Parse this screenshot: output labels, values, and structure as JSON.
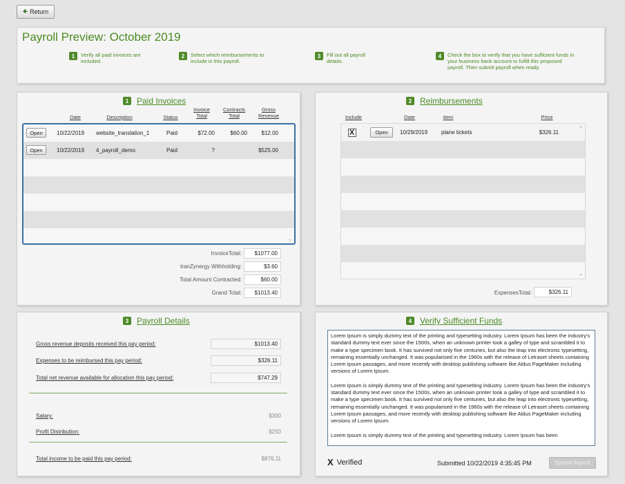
{
  "nav": {
    "return_label": "Return"
  },
  "header": {
    "title": "Payroll Preview:  October 2019",
    "steps": [
      {
        "num": "1",
        "text": "Verify all paid invoices are included."
      },
      {
        "num": "2",
        "text": "Select which reimbursements to include in this payroll."
      },
      {
        "num": "3",
        "text": "Fill out all payroll details."
      },
      {
        "num": "4",
        "text": "Check the box to verify that you have sufficient funds in your business bank account to fulfill this proposed payroll. Then submit payroll when ready."
      }
    ]
  },
  "invoices": {
    "num": "1",
    "title": "Paid Invoices",
    "columns": [
      "Date",
      "Description",
      "Status",
      "Invoice Total",
      "Contracts Total",
      "Gross Revenue"
    ],
    "open_label": "Open",
    "rows": [
      {
        "date": "10/22/2019",
        "description": "website_translation_1",
        "status": "Paid",
        "invoice_total": "$72.00",
        "contracts_total": "$60.00",
        "gross_revenue": "$12.00"
      },
      {
        "date": "10/22/2019",
        "description": "4_payroll_demo",
        "status": "Paid",
        "invoice_total": "?",
        "contracts_total": "",
        "gross_revenue": "$525.00"
      }
    ],
    "totals": [
      {
        "label": "InvoiceTotal:",
        "value": "$1077.00"
      },
      {
        "label": "tranZynergy Withholding:",
        "value": "$3.60"
      },
      {
        "label": "Total Amount Contracted:",
        "value": "$60.00"
      },
      {
        "label": "Grand Total:",
        "value": "$1013.40"
      }
    ]
  },
  "reimbursements": {
    "num": "2",
    "title": "Reimbursements",
    "columns": [
      "Include",
      "Date",
      "Item",
      "Price"
    ],
    "open_label": "Open",
    "rows": [
      {
        "include": "X",
        "date": "10/29/2019",
        "item": "plane tickets",
        "price": "$326.11"
      }
    ],
    "expenses_label": "ExpensesTotal:",
    "expenses_value": "$326.11"
  },
  "details": {
    "num": "3",
    "title": "Payroll Details",
    "gross_label": "Gross revenue deposits received this pay period:",
    "gross_value": "$1013.40",
    "expenses_label": "Expenses to be reimbursed this pay period:",
    "expenses_value": "$326.11",
    "net_label": "Total net revenue available for allocation this pay period:",
    "net_value": "$747.29",
    "salary_label": "Salary:",
    "salary_value": "$300",
    "profit_label": "Profit Distribution:",
    "profit_value": "$250",
    "total_label": "Total income to be paid this pay period:",
    "total_value": "$876.11"
  },
  "verify": {
    "num": "4",
    "title": "Verify Sufficient Funds",
    "paragraphs": [
      "Lorem Ipsum is simply dummy text of the printing and typesetting industry. Lorem Ipsum has been the industry's standard dummy text ever since the 1500s, when an unknown printer took a galley of type and scrambled it to make a type specimen book. It has survived not only five centuries, but also the leap into electronic typesetting, remaining essentially unchanged. It was popularised in the 1960s with the release of Letraset sheets containing Lorem Ipsum passages, and more recently with desktop publishing software like Aldus PageMaker including versions of Lorem Ipsum.",
      "Lorem Ipsum is simply dummy text of the printing and typesetting industry. Lorem Ipsum has been the industry's standard dummy text ever since the 1500s, when an unknown printer took a galley of type and scrambled it to make a type specimen book. It has survived not only five centuries, but also the leap into electronic typesetting, remaining essentially unchanged. It was popularised in the 1960s with the release of Letraset sheets containing Lorem Ipsum passages, and more recently with desktop publishing software like Aldus PageMaker including versions of Lorem Ipsum.",
      "Lorem Ipsum is simply dummy text of the printing and typesetting industry. Lorem Ipsum has been"
    ],
    "verified_mark": "X",
    "verified_label": "Verified",
    "submitted_text": "Submitted 10/22/2019 4:35:45 PM",
    "submit_label": "Submit Payroll"
  },
  "colors": {
    "accent": "#4a8a22",
    "badge": "#4f8a28",
    "selection_border": "#3a6ea5"
  }
}
